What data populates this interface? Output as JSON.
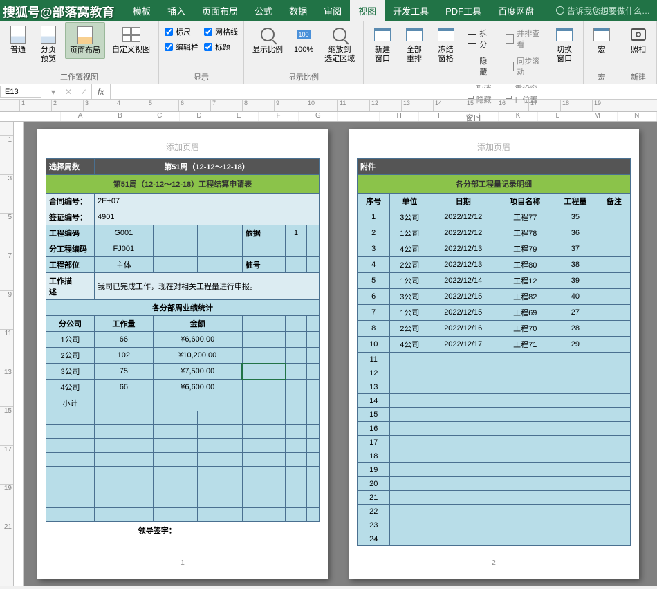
{
  "watermark": "搜狐号@部落窝教育",
  "menu": {
    "tabs": [
      "模板",
      "插入",
      "页面布局",
      "公式",
      "数据",
      "审阅",
      "视图",
      "开发工具",
      "PDF工具",
      "百度网盘"
    ],
    "active": 6,
    "tellme": "告诉我您想要做什么…"
  },
  "ribbon": {
    "views": {
      "group": "工作簿视图",
      "items": [
        "普通",
        "分页\n预览",
        "页面布局",
        "自定义视图"
      ],
      "active": 2
    },
    "show": {
      "group": "显示",
      "checks": [
        [
          "标尺",
          true
        ],
        [
          "编辑栏",
          true
        ],
        [
          "网格线",
          true
        ],
        [
          "标题",
          true
        ]
      ]
    },
    "zoom": {
      "group": "显示比例",
      "items": [
        "显示比例",
        "100%",
        "缩放到\n选定区域"
      ]
    },
    "window": {
      "group": "窗口",
      "big": [
        "新建窗口",
        "全部重排",
        "冻结窗格"
      ],
      "small": [
        "拆分",
        "隐藏",
        "取消隐藏",
        "并排查看",
        "同步滚动",
        "重设窗口位置"
      ],
      "switch": "切换窗口"
    },
    "macro": {
      "group": "宏",
      "item": "宏"
    },
    "shot": {
      "group": "新建",
      "item": "照相"
    }
  },
  "namebox": "E13",
  "ruler_h": [
    "1",
    "2",
    "3",
    "4",
    "5",
    "6",
    "7",
    "8",
    "9",
    "10",
    "11",
    "12",
    "13",
    "14",
    "15",
    "16",
    "17",
    "18",
    "19"
  ],
  "cols_left": [
    "A",
    "B",
    "C",
    "D",
    "E",
    "F",
    "G"
  ],
  "cols_right": [
    "H",
    "I",
    "J",
    "K",
    "L",
    "M",
    "N"
  ],
  "ruler_v": [
    "1",
    "3",
    "5",
    "7",
    "9",
    "11",
    "13",
    "15",
    "17",
    "19",
    "21"
  ],
  "page_header": "添加页眉",
  "p1": {
    "select_label": "选择周数",
    "week_title": "第51周（12-12～12-18）",
    "title": "第51周（12-12～12-18）工程结算申请表",
    "fields": {
      "contract_label": "合同编号：",
      "contract": "2E+07",
      "visa_label": "签证编号：",
      "visa": "4901",
      "proj_label": "工程编码",
      "proj": "G001",
      "basis_label": "依据",
      "basis": "1",
      "sub_label": "分工程编码",
      "sub": "FJ001",
      "part_label": "工程部位",
      "part": "主体",
      "pile_label": "桩号"
    },
    "desc_label": "工作描\n述",
    "desc": "我司已完成工作，现在对相关工程量进行申报。",
    "stats_title": "各分部周业绩统计",
    "stats_head": [
      "分公司",
      "工作量",
      "金额"
    ],
    "stats_rows": [
      [
        "1公司",
        "66",
        "¥6,600.00"
      ],
      [
        "2公司",
        "102",
        "¥10,200.00"
      ],
      [
        "3公司",
        "75",
        "¥7,500.00"
      ],
      [
        "4公司",
        "66",
        "¥6,600.00"
      ]
    ],
    "subtotal": "小计",
    "sign": "领导签字：",
    "pagenum": "1"
  },
  "p2": {
    "attach": "附件",
    "title": "各分部工程量记录明细",
    "head": [
      "序号",
      "单位",
      "日期",
      "项目名称",
      "工程量",
      "备注"
    ],
    "rows": [
      [
        "1",
        "3公司",
        "2022/12/12",
        "工程77",
        "35",
        ""
      ],
      [
        "2",
        "1公司",
        "2022/12/12",
        "工程78",
        "36",
        ""
      ],
      [
        "3",
        "4公司",
        "2022/12/13",
        "工程79",
        "37",
        ""
      ],
      [
        "4",
        "2公司",
        "2022/12/13",
        "工程80",
        "38",
        ""
      ],
      [
        "5",
        "1公司",
        "2022/12/14",
        "工程12",
        "39",
        ""
      ],
      [
        "6",
        "3公司",
        "2022/12/15",
        "工程82",
        "40",
        ""
      ],
      [
        "7",
        "1公司",
        "2022/12/15",
        "工程69",
        "27",
        ""
      ],
      [
        "8",
        "2公司",
        "2022/12/16",
        "工程70",
        "28",
        ""
      ],
      [
        "10",
        "4公司",
        "2022/12/17",
        "工程71",
        "29",
        ""
      ]
    ],
    "empty_rows": [
      "11",
      "12",
      "13",
      "14",
      "15",
      "16",
      "17",
      "18",
      "19",
      "20",
      "21",
      "22",
      "23",
      "24"
    ],
    "pagenum": "2"
  }
}
